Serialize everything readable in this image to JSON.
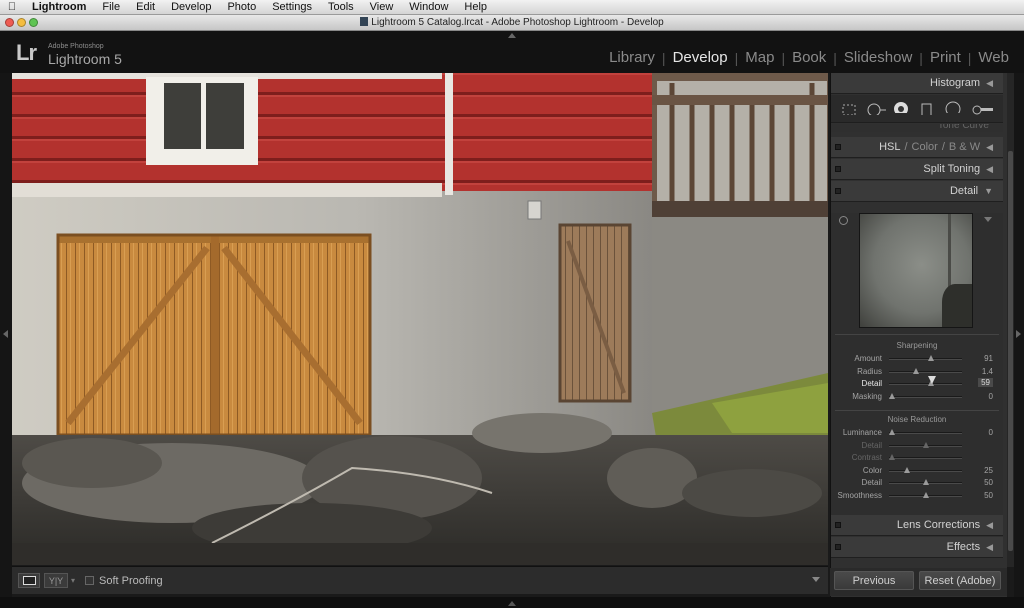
{
  "menubar": {
    "app_name": "Lightroom",
    "items": [
      "File",
      "Edit",
      "Develop",
      "Photo",
      "Settings",
      "Tools",
      "View",
      "Window",
      "Help"
    ]
  },
  "window": {
    "title": "Lightroom 5 Catalog.lrcat - Adobe Photoshop Lightroom - Develop"
  },
  "identity": {
    "logo": "Lr",
    "brand": "Adobe Photoshop",
    "product": "Lightroom 5"
  },
  "modules": [
    {
      "label": "Library",
      "active": false
    },
    {
      "label": "Develop",
      "active": true
    },
    {
      "label": "Map",
      "active": false
    },
    {
      "label": "Book",
      "active": false
    },
    {
      "label": "Slideshow",
      "active": false
    },
    {
      "label": "Print",
      "active": false
    },
    {
      "label": "Web",
      "active": false
    }
  ],
  "toolbar": {
    "compare_label": "Y|Y",
    "soft_proofing": "Soft Proofing"
  },
  "panels": {
    "histogram": "Histogram",
    "tone_curve": "Tone Curve",
    "hsl": {
      "a": "HSL",
      "b": "Color",
      "c": "B & W",
      "sep": "/"
    },
    "split_toning": "Split Toning",
    "detail": "Detail",
    "lens_corrections": "Lens Corrections",
    "effects": "Effects"
  },
  "detail": {
    "sharpening_title": "Sharpening",
    "sharpening": [
      {
        "label": "Amount",
        "value": "91",
        "pos": 0.58
      },
      {
        "label": "Radius",
        "value": "1.4",
        "pos": 0.37
      },
      {
        "label": "Detail",
        "value": "59",
        "pos": 0.57,
        "highlight": true
      },
      {
        "label": "Masking",
        "value": "0",
        "pos": 0.04
      }
    ],
    "noise_title": "Noise Reduction",
    "noise": [
      {
        "label": "Luminance",
        "value": "0",
        "pos": 0.04,
        "enabled": true
      },
      {
        "label": "Detail",
        "value": "",
        "pos": 0.5,
        "enabled": false
      },
      {
        "label": "Contrast",
        "value": "",
        "pos": 0.04,
        "enabled": false
      },
      {
        "label": "Color",
        "value": "25",
        "pos": 0.25,
        "enabled": true
      },
      {
        "label": "Detail",
        "value": "50",
        "pos": 0.5,
        "enabled": true
      },
      {
        "label": "Smoothness",
        "value": "50",
        "pos": 0.5,
        "enabled": true
      }
    ]
  },
  "buttons": {
    "previous": "Previous",
    "reset": "Reset (Adobe)"
  },
  "colors": {
    "accent_active": "#e6e6e6",
    "panel_bg": "#303030",
    "barn_red": "#b0302d",
    "door_wood": "#c8893c"
  }
}
